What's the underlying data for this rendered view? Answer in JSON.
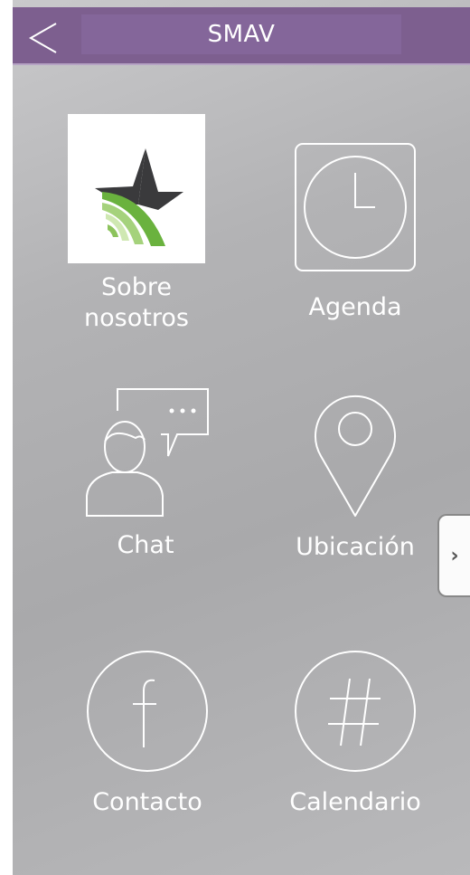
{
  "header": {
    "title": "SMAV",
    "back_icon": "chevron-left-icon"
  },
  "tiles": [
    {
      "label_line1": "Sobre",
      "label_line2": "nosotros",
      "icon": "star-logo-icon"
    },
    {
      "label": "Agenda",
      "icon": "clock-icon"
    },
    {
      "label": "Chat",
      "icon": "chat-person-icon"
    },
    {
      "label": "Ubicación",
      "icon": "map-pin-icon"
    },
    {
      "label": "Contacto",
      "icon": "facebook-icon"
    },
    {
      "label": "Calendario",
      "icon": "hashtag-icon"
    }
  ],
  "side_tab": {
    "glyph": "›",
    "icon": "chevron-right-icon"
  },
  "colors": {
    "header": "#7d5f8f",
    "background": "#b3b3b5",
    "logo_green": "#6ab23e",
    "logo_dark": "#3a3a3c"
  }
}
